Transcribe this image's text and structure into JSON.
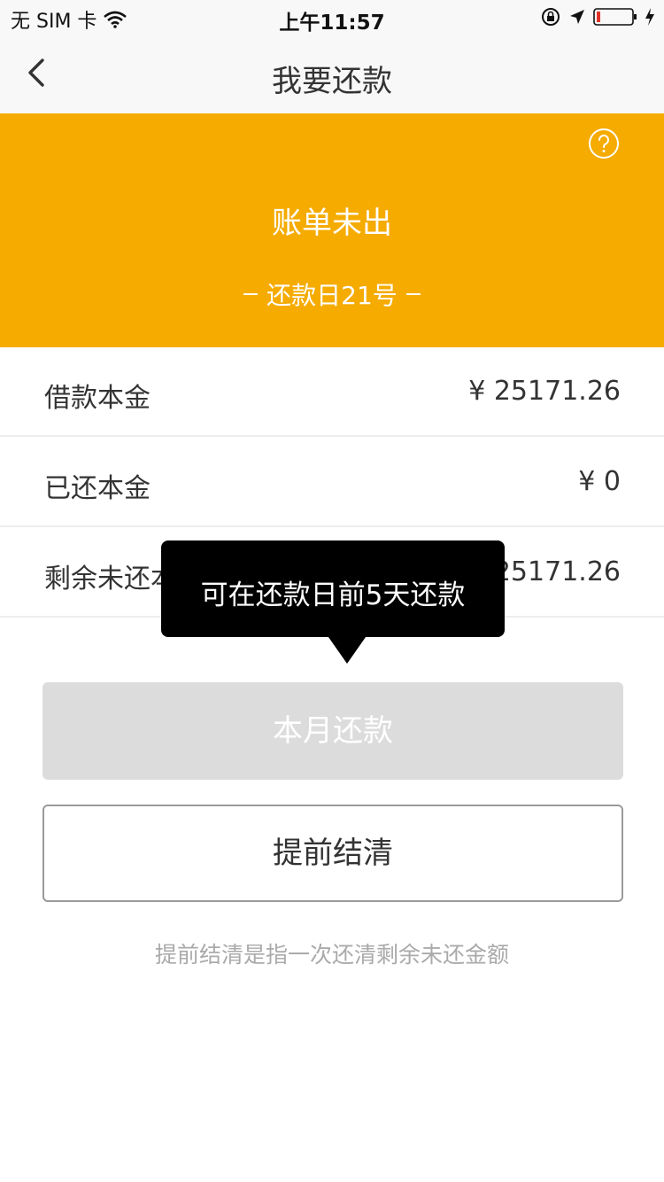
{
  "status_bar": {
    "carrier": "无 SIM 卡",
    "time": "上午11:57"
  },
  "nav": {
    "title": "我要还款"
  },
  "banner": {
    "status": "账单未出",
    "due_day": "还款日21号",
    "background_color": "#f5ab00"
  },
  "rows": [
    {
      "label": "借款本金",
      "value": "¥ 25171.26"
    },
    {
      "label": "已还本金",
      "value": "¥ 0"
    },
    {
      "label": "剩余未还本金",
      "value": "¥ 25171.26"
    }
  ],
  "tooltip": {
    "text": "可在还款日前5天还款"
  },
  "buttons": {
    "this_month": "本月还款",
    "settle_early": "提前结清"
  },
  "note": "提前结清是指一次还清剩余未还金额",
  "icons": [
    "wifi-icon",
    "orientation-lock-icon",
    "location-arrow-icon",
    "battery-icon",
    "charging-bolt-icon",
    "back-chevron-icon",
    "help-question-icon"
  ]
}
